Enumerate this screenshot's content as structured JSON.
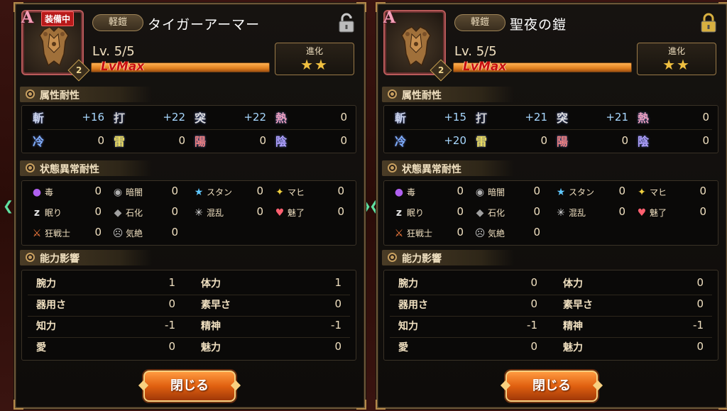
{
  "panels": [
    {
      "rarity": "A",
      "equipped_label": "装備中",
      "item_level_badge": "2",
      "type": "軽鎧",
      "name": "タイガーアーマー",
      "lock_state": "unlocked",
      "level": "Lv. 5/5",
      "level_progress": 1.0,
      "lvmax_label": "LvMax",
      "evolution_label": "進化",
      "evolution_stars": "★★",
      "sections": {
        "attr": "属性耐性",
        "status": "状態異常耐性",
        "ability": "能力影響"
      },
      "attr_resist": [
        {
          "icon": "slash-icon",
          "glyph": "斬",
          "value": "+16"
        },
        {
          "icon": "strike-icon",
          "glyph": "打",
          "value": "+22"
        },
        {
          "icon": "pierce-icon",
          "glyph": "突",
          "value": "+22"
        },
        {
          "icon": "fire-icon",
          "glyph": "熱",
          "value": "0"
        },
        {
          "icon": "cold-icon",
          "glyph": "冷",
          "value": "0"
        },
        {
          "icon": "thunder-icon",
          "glyph": "雷",
          "value": "0"
        },
        {
          "icon": "light-icon",
          "glyph": "陽",
          "value": "0"
        },
        {
          "icon": "dark-icon",
          "glyph": "陰",
          "value": "0"
        }
      ],
      "status_resist": [
        {
          "icon": "poison-icon",
          "label": "毒",
          "value": "0"
        },
        {
          "icon": "blind-icon",
          "label": "暗闇",
          "value": "0"
        },
        {
          "icon": "stun-icon",
          "label": "スタン",
          "value": "0"
        },
        {
          "icon": "paralysis-icon",
          "label": "マヒ",
          "value": "0"
        },
        {
          "icon": "sleep-icon",
          "label": "眠り",
          "value": "0"
        },
        {
          "icon": "petrify-icon",
          "label": "石化",
          "value": "0"
        },
        {
          "icon": "confusion-icon",
          "label": "混乱",
          "value": "0"
        },
        {
          "icon": "charm-icon",
          "label": "魅了",
          "value": "0"
        },
        {
          "icon": "berserk-icon",
          "label": "狂戦士",
          "value": "0"
        },
        {
          "icon": "faint-icon",
          "label": "気絶",
          "value": "0"
        }
      ],
      "abilities": [
        {
          "label": "腕力",
          "value": "1"
        },
        {
          "label": "体力",
          "value": "1"
        },
        {
          "label": "器用さ",
          "value": "0"
        },
        {
          "label": "素早さ",
          "value": "0"
        },
        {
          "label": "知力",
          "value": "-1"
        },
        {
          "label": "精神",
          "value": "-1"
        },
        {
          "label": "愛",
          "value": "0"
        },
        {
          "label": "魅力",
          "value": "0"
        }
      ],
      "close_label": "閉じる"
    },
    {
      "rarity": "A",
      "item_level_badge": "2",
      "type": "軽鎧",
      "name": "聖夜の鎧",
      "lock_state": "locked",
      "level": "Lv. 5/5",
      "level_progress": 1.0,
      "lvmax_label": "LvMax",
      "evolution_label": "進化",
      "evolution_stars": "★★",
      "sections": {
        "attr": "属性耐性",
        "status": "状態異常耐性",
        "ability": "能力影響"
      },
      "attr_resist": [
        {
          "icon": "slash-icon",
          "glyph": "斬",
          "value": "+15"
        },
        {
          "icon": "strike-icon",
          "glyph": "打",
          "value": "+21"
        },
        {
          "icon": "pierce-icon",
          "glyph": "突",
          "value": "+21"
        },
        {
          "icon": "fire-icon",
          "glyph": "熱",
          "value": "0"
        },
        {
          "icon": "cold-icon",
          "glyph": "冷",
          "value": "+20"
        },
        {
          "icon": "thunder-icon",
          "glyph": "雷",
          "value": "0"
        },
        {
          "icon": "light-icon",
          "glyph": "陽",
          "value": "0"
        },
        {
          "icon": "dark-icon",
          "glyph": "陰",
          "value": "0"
        }
      ],
      "status_resist": [
        {
          "icon": "poison-icon",
          "label": "毒",
          "value": "0"
        },
        {
          "icon": "blind-icon",
          "label": "暗闇",
          "value": "0"
        },
        {
          "icon": "stun-icon",
          "label": "スタン",
          "value": "0"
        },
        {
          "icon": "paralysis-icon",
          "label": "マヒ",
          "value": "0"
        },
        {
          "icon": "sleep-icon",
          "label": "眠り",
          "value": "0"
        },
        {
          "icon": "petrify-icon",
          "label": "石化",
          "value": "0"
        },
        {
          "icon": "confusion-icon",
          "label": "混乱",
          "value": "0"
        },
        {
          "icon": "charm-icon",
          "label": "魅了",
          "value": "0"
        },
        {
          "icon": "berserk-icon",
          "label": "狂戦士",
          "value": "0"
        },
        {
          "icon": "faint-icon",
          "label": "気絶",
          "value": "0"
        }
      ],
      "abilities": [
        {
          "label": "腕力",
          "value": "0"
        },
        {
          "label": "体力",
          "value": "0"
        },
        {
          "label": "器用さ",
          "value": "0"
        },
        {
          "label": "素早さ",
          "value": "0"
        },
        {
          "label": "知力",
          "value": "-1"
        },
        {
          "label": "精神",
          "value": "-1"
        },
        {
          "label": "愛",
          "value": "0"
        },
        {
          "label": "魅力",
          "value": "0"
        }
      ],
      "close_label": "閉じる"
    }
  ],
  "colors": {
    "panel_border": "#6b5637",
    "positive_value": "#a8d8ff",
    "button_orange": "#e06010",
    "star_gold": "#f0c040",
    "nav_arrow": "#60e0a0"
  }
}
